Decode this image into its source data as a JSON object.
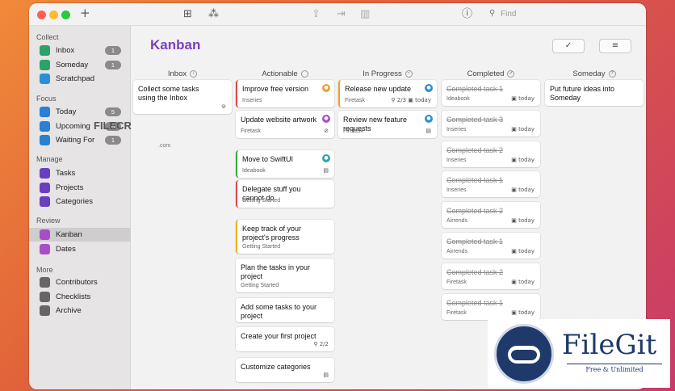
{
  "toolbar": {
    "search_placeholder": "Find",
    "add_glyph": "+",
    "info_glyph": "ⓘ"
  },
  "sidebar": {
    "sections": [
      {
        "title": "Collect",
        "items": [
          {
            "label": "Inbox",
            "icon": "inbox-icon",
            "color": "#2aa36b",
            "badge": "1"
          },
          {
            "label": "Someday",
            "icon": "someday-icon",
            "color": "#2aa36b",
            "badge": "1"
          },
          {
            "label": "Scratchpad",
            "icon": "scratchpad-icon",
            "color": "#2a8fd6",
            "badge": ""
          }
        ]
      },
      {
        "title": "Focus",
        "items": [
          {
            "label": "Today",
            "icon": "today-icon",
            "color": "#2a7fd6",
            "badge": "5"
          },
          {
            "label": "Upcoming",
            "icon": "upcoming-icon",
            "color": "#2a7fd6",
            "badge": "6"
          },
          {
            "label": "Waiting For",
            "icon": "waiting-icon",
            "color": "#2a7fd6",
            "badge": "1"
          }
        ]
      },
      {
        "title": "Manage",
        "items": [
          {
            "label": "Tasks",
            "icon": "tasks-icon",
            "color": "#6a3fbf",
            "badge": ""
          },
          {
            "label": "Projects",
            "icon": "projects-icon",
            "color": "#6a3fbf",
            "badge": ""
          },
          {
            "label": "Categories",
            "icon": "categories-icon",
            "color": "#6a3fbf",
            "badge": ""
          }
        ]
      },
      {
        "title": "Review",
        "items": [
          {
            "label": "Kanban",
            "icon": "kanban-icon",
            "color": "#a84fc8",
            "badge": "",
            "selected": true
          },
          {
            "label": "Dates",
            "icon": "dates-icon",
            "color": "#a84fc8",
            "badge": ""
          }
        ]
      },
      {
        "title": "More",
        "items": [
          {
            "label": "Contributors",
            "icon": "contributors-icon",
            "color": "#666",
            "badge": ""
          },
          {
            "label": "Checklists",
            "icon": "checklists-icon",
            "color": "#666",
            "badge": ""
          },
          {
            "label": "Archive",
            "icon": "archive-icon",
            "color": "#666",
            "badge": ""
          }
        ]
      }
    ]
  },
  "main": {
    "title": "Kanban",
    "check_glyph": "✓",
    "filter_glyph": "≡"
  },
  "columns": [
    {
      "label": "Inbox",
      "icon": "inbox-icon",
      "glyph": "↓",
      "cards": [
        {
          "title": "Collect some tasks using the Inbox",
          "subtitle": "",
          "meta": "⊘",
          "bar": "",
          "dot": ""
        }
      ]
    },
    {
      "label": "Actionable",
      "icon": "actionable-icon",
      "glyph": "",
      "cards": [
        {
          "title": "Improve free version",
          "subtitle": "Inseries",
          "meta": "",
          "bar": "#d84a4a",
          "dot": "#f0a030"
        },
        {
          "title": "Update website artwork",
          "subtitle": "Firetask",
          "meta": "⊘",
          "bar": "",
          "dot": "#a84fc8"
        },
        {
          "title": "Move to SwiftUI",
          "subtitle": "Ideabook",
          "meta": "▤",
          "bar": "#3aa83a",
          "dot": "#3aa0b0"
        },
        {
          "title": "Delegate stuff you cannot do",
          "subtitle": "Getting Started",
          "meta": "",
          "bar": "#d84a4a",
          "dot": ""
        },
        {
          "title": "Keep track of your project's progress",
          "subtitle": "Getting Started",
          "meta": "",
          "bar": "#f0b020",
          "dot": ""
        },
        {
          "title": "Plan the tasks in your project",
          "subtitle": "Getting Started",
          "meta": "",
          "bar": "",
          "dot": ""
        },
        {
          "title": "Add some tasks to your project",
          "subtitle": "",
          "meta": "",
          "bar": "",
          "dot": ""
        },
        {
          "title": "Create your first project",
          "subtitle": "",
          "meta": "⚲ 2/2",
          "bar": "",
          "dot": ""
        },
        {
          "title": "Customize categories",
          "subtitle": "",
          "meta": "▤",
          "bar": "",
          "dot": ""
        }
      ]
    },
    {
      "label": "In Progress",
      "icon": "in-progress-icon",
      "glyph": "~",
      "cards": [
        {
          "title": "Release new update",
          "subtitle": "Firetask",
          "meta": "⚲ 2/3  ▣ today",
          "bar": "#f0a030",
          "dot": "#2a8fd6"
        },
        {
          "title": "Review new feature requests",
          "subtitle": "Firetask",
          "meta": "▤",
          "bar": "",
          "dot": "#2a8fd6"
        }
      ]
    },
    {
      "label": "Completed",
      "icon": "completed-icon",
      "glyph": "✓",
      "cards": [
        {
          "title": "Completed task 1",
          "subtitle": "Ideabook",
          "meta": "▣ today",
          "bar": "",
          "dot": ""
        },
        {
          "title": "Completed task 3",
          "subtitle": "Inseries",
          "meta": "▣ today",
          "bar": "",
          "dot": ""
        },
        {
          "title": "Completed task 2",
          "subtitle": "Inseries",
          "meta": "▣ today",
          "bar": "",
          "dot": ""
        },
        {
          "title": "Completed task 1",
          "subtitle": "Inseries",
          "meta": "▣ today",
          "bar": "",
          "dot": ""
        },
        {
          "title": "Completed task 2",
          "subtitle": "Airrends",
          "meta": "▣ today",
          "bar": "",
          "dot": ""
        },
        {
          "title": "Completed task 1",
          "subtitle": "Airrends",
          "meta": "▣ today",
          "bar": "",
          "dot": ""
        },
        {
          "title": "Completed task 2",
          "subtitle": "Firetask",
          "meta": "▣ today",
          "bar": "",
          "dot": ""
        },
        {
          "title": "Completed task 1",
          "subtitle": "Firetask",
          "meta": "▣ today",
          "bar": "",
          "dot": ""
        }
      ]
    },
    {
      "label": "Someday",
      "icon": "someday-icon",
      "glyph": "?",
      "cards": [
        {
          "title": "Put future ideas into Someday",
          "subtitle": "",
          "meta": "",
          "bar": "",
          "dot": ""
        }
      ]
    }
  ],
  "watermarks": {
    "filecr": "FILECR",
    "filecr_sub": ".com",
    "filegit": "FileGit",
    "filegit_tag": "Free & Unlimited"
  }
}
